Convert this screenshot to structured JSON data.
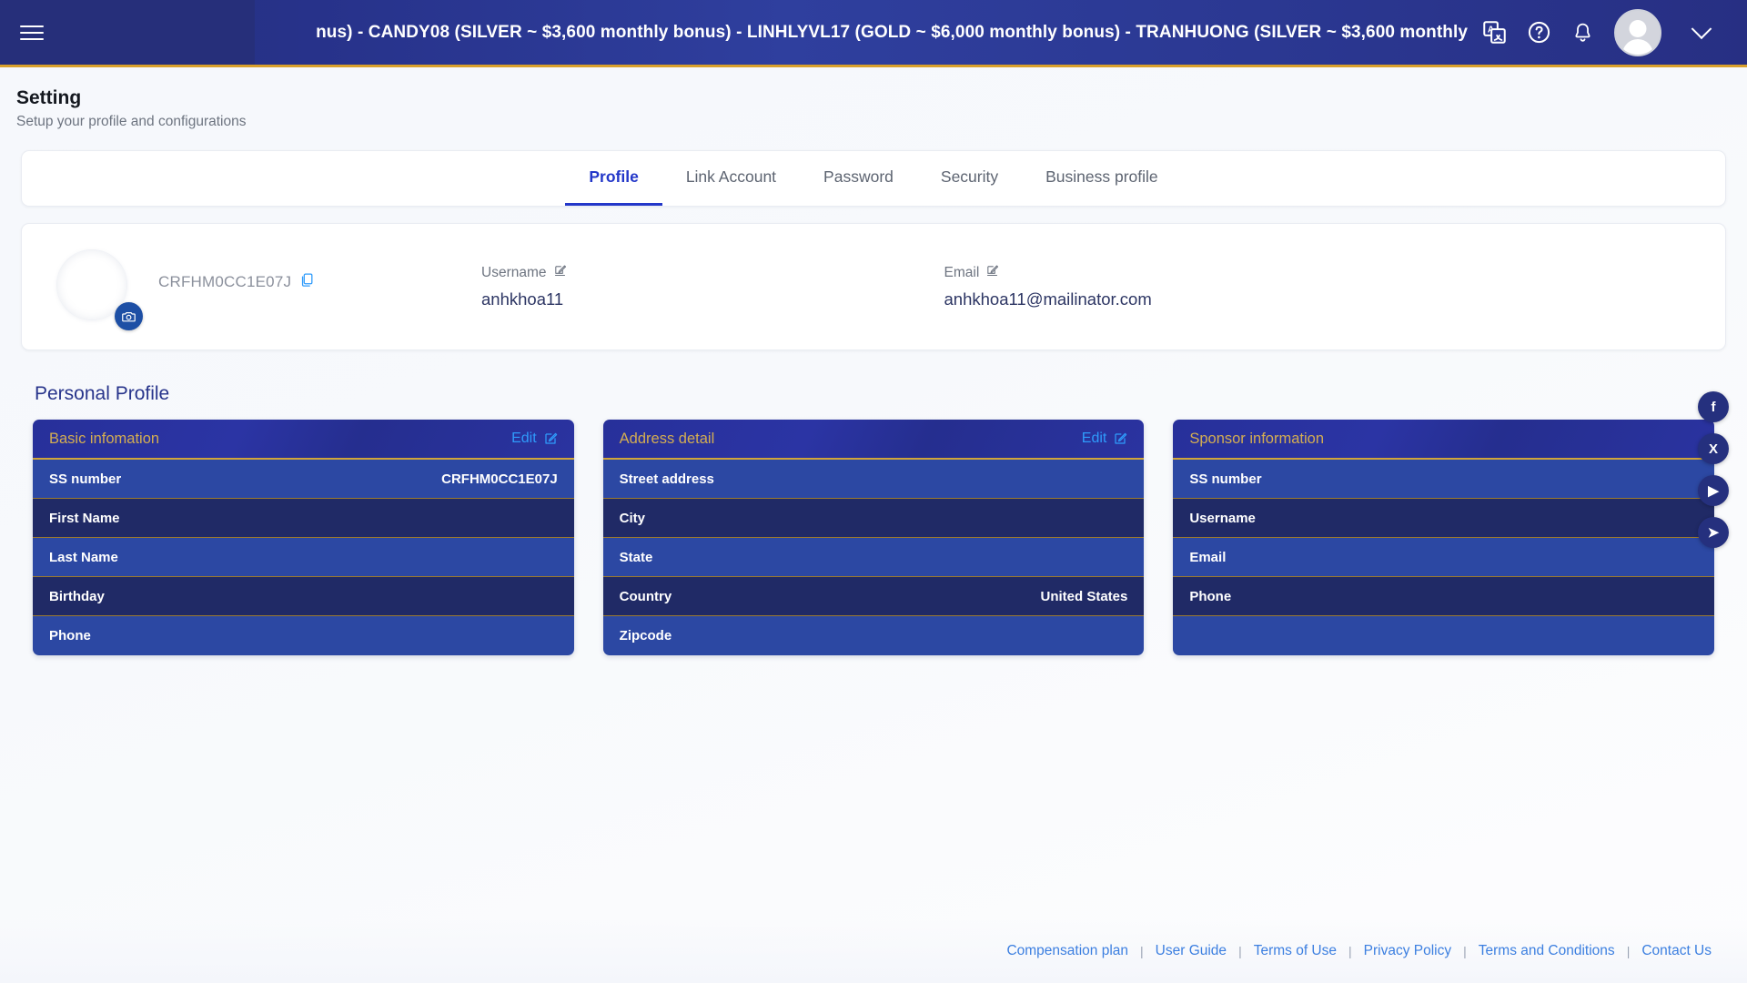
{
  "topbar": {
    "menu_icon": "hamburger-icon",
    "marquee": "nus) - CANDY08 (SILVER ~ $3,600 monthly bonus) - LINHLYVL17 (GOLD ~ $6,000 monthly bonus) - TRANHUONG (SILVER ~ $3,600 monthly",
    "translate_icon": "translate-icon",
    "help_icon": "help-circle-icon",
    "bell_icon": "notification-bell-icon",
    "avatar_icon": "user-avatar",
    "chevron_icon": "chevron-down-icon"
  },
  "page": {
    "title": "Setting",
    "subtitle": "Setup your profile and configurations"
  },
  "tabs": [
    {
      "label": "Profile",
      "active": true
    },
    {
      "label": "Link Account",
      "active": false
    },
    {
      "label": "Password",
      "active": false
    },
    {
      "label": "Security",
      "active": false
    },
    {
      "label": "Business profile",
      "active": false
    }
  ],
  "identity": {
    "ss_id": "CRFHM0CC1E07J",
    "copy_icon": "copy-icon",
    "camera_icon": "camera-icon",
    "username_label": "Username",
    "username_value": "anhkhoa11",
    "email_label": "Email",
    "email_value": "anhkhoa11@mailinator.com",
    "edit_icon": "edit-pencil-icon"
  },
  "personal_profile": {
    "section_title": "Personal Profile",
    "edit_label": "Edit",
    "cards": [
      {
        "title": "Basic infomation",
        "has_edit": true,
        "rows": [
          {
            "key": "SS number",
            "value": "CRFHM0CC1E07J"
          },
          {
            "key": "First Name",
            "value": ""
          },
          {
            "key": "Last Name",
            "value": ""
          },
          {
            "key": "Birthday",
            "value": ""
          },
          {
            "key": "Phone",
            "value": ""
          }
        ]
      },
      {
        "title": "Address detail",
        "has_edit": true,
        "rows": [
          {
            "key": "Street address",
            "value": ""
          },
          {
            "key": "City",
            "value": ""
          },
          {
            "key": "State",
            "value": ""
          },
          {
            "key": "Country",
            "value": "United States"
          },
          {
            "key": "Zipcode",
            "value": ""
          }
        ]
      },
      {
        "title": "Sponsor information",
        "has_edit": false,
        "rows": [
          {
            "key": "SS number",
            "value": ""
          },
          {
            "key": "Username",
            "value": ""
          },
          {
            "key": "Email",
            "value": ""
          },
          {
            "key": "Phone",
            "value": ""
          },
          {
            "key": "",
            "value": ""
          }
        ]
      }
    ]
  },
  "social": [
    {
      "name": "facebook-icon",
      "glyph": "f"
    },
    {
      "name": "x-twitter-icon",
      "glyph": "X"
    },
    {
      "name": "youtube-icon",
      "glyph": "▶"
    },
    {
      "name": "telegram-icon",
      "glyph": "➤"
    }
  ],
  "footer": {
    "links": [
      "Compensation plan",
      "User Guide",
      "Terms of Use",
      "Privacy Policy",
      "Terms and Conditions",
      "Contact Us"
    ],
    "separator": "|"
  },
  "colors": {
    "brand_navy": "#25307e",
    "accent_gold": "#d0a43a",
    "tab_active": "#2337c9",
    "link_blue": "#3c7fe0",
    "row_light": "#2c48a3",
    "row_dark": "#202a66"
  }
}
